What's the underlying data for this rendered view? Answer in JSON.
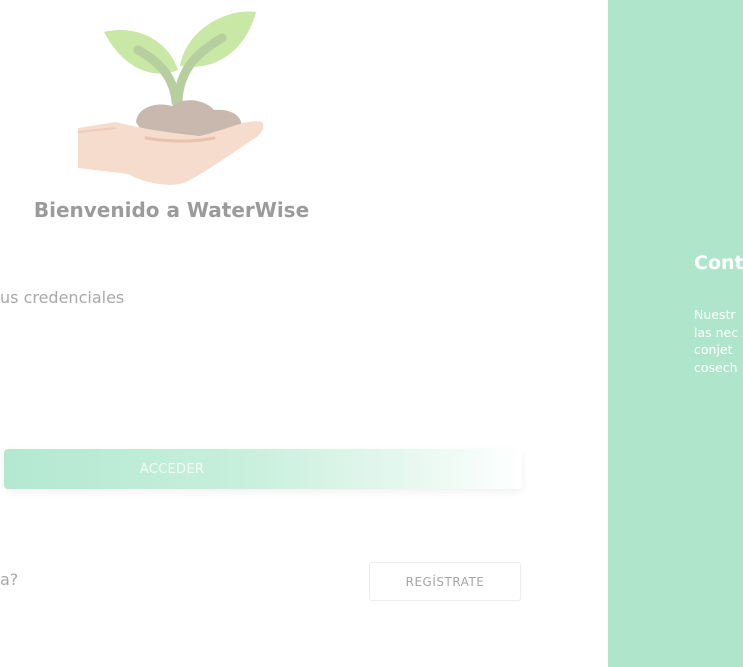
{
  "login": {
    "welcome": "Bienvenido a WaterWise",
    "subtitle": "us credenciales",
    "submit_label": "ACCEDER",
    "question": "a?",
    "register_label": "REGÍSTRATE"
  },
  "side_panel": {
    "title": "Cont",
    "text_lines": [
      "Nuestr",
      "las nec",
      "conjet",
      "cosech"
    ]
  },
  "icons": {
    "logo": "hand-holding-seedling-icon"
  },
  "colors": {
    "accent": "#aee5cb",
    "button_gradient_start": "#b4e8d1",
    "muted_text": "#a9a9a9",
    "white": "#ffffff"
  }
}
